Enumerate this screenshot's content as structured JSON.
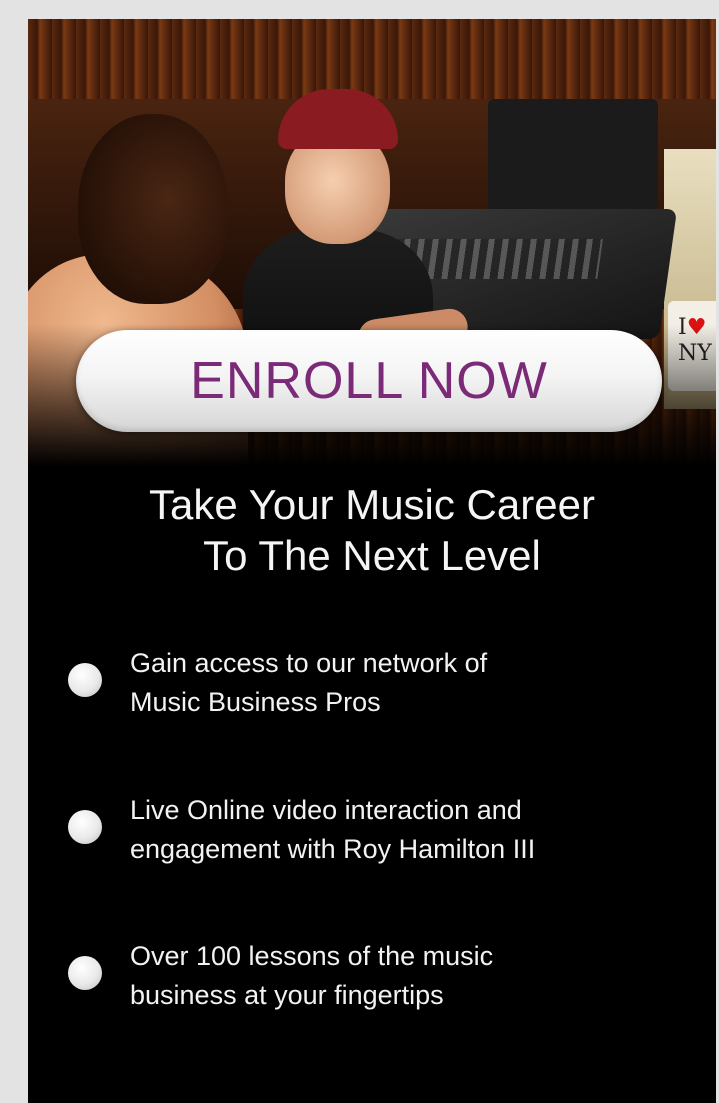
{
  "hero": {
    "mug_text_line1": "I",
    "mug_heart": "♥",
    "mug_text_line2": "NY"
  },
  "enroll_button": {
    "label": "ENROLL NOW",
    "text_color": "#7b2a78"
  },
  "headline": {
    "line1": "Take Your Music Career",
    "line2": "To The Next Level"
  },
  "features": [
    {
      "text": "Gain access to our network of\nMusic Business Pros"
    },
    {
      "text": "Live Online video interaction and\nengagement with Roy Hamilton III"
    },
    {
      "text": "Over 100 lessons of the music\nbusiness at your fingertips"
    }
  ],
  "colors": {
    "page_background": "#e3e3e3",
    "card_background": "#000000",
    "text": "#f2f2f2"
  }
}
